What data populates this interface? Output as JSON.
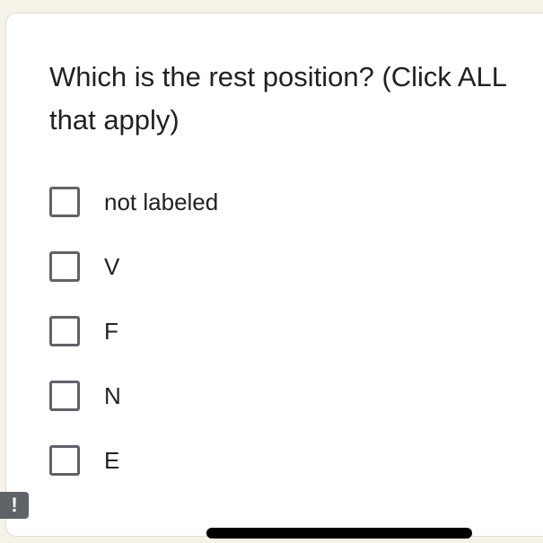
{
  "question": {
    "text": "Which is the rest position? (Click ALL that apply)"
  },
  "options": [
    {
      "label": "not labeled",
      "checked": false
    },
    {
      "label": "V",
      "checked": false
    },
    {
      "label": "F",
      "checked": false
    },
    {
      "label": "N",
      "checked": false
    },
    {
      "label": "E",
      "checked": false
    }
  ],
  "side_tab": {
    "glyph": "!",
    "icon": "exclamation-icon"
  },
  "colors": {
    "background": "#f5f2e7",
    "card": "#ffffff",
    "checkbox_border": "#5f6368",
    "text": "#202124"
  }
}
